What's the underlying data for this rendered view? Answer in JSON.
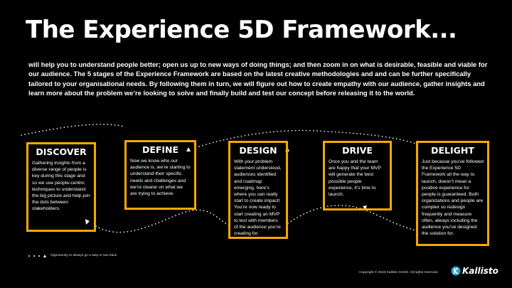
{
  "title": "The Experience 5D Framework...",
  "intro": "will help you to understand people better; open us up to new ways of doing things; and then zoom in on what is desirable, feasible and viable for our audience. The 5 stages of the Experience Framework are based on the latest creative methodologies and and can be further specifically tailored to your organisational needs. By following them in turn, we will figure out how to create empathy with our audience, gather insights and learn more about the problem we’re looking to solve and finally build and test our concept before releasing it to the world.",
  "stages": [
    {
      "label": "DISCOVER",
      "text": "Gathering insights from a diverse range of people is key during this stage and so we use people-centric techniques to understand the big picture and help join the dots between stakeholders."
    },
    {
      "label": "DEFINE",
      "text": "Now we know who our audience is, we’re starting to understand their specific needs and challenges and we’re clearer on what we are trying to achieve."
    },
    {
      "label": "DESIGN",
      "text": "With your problem statement understood, audiences identified and roadmap emerging, here’s where you can really start to create impact! You’re now ready to start creating an MVP to test with members of the audience you’re creating for."
    },
    {
      "label": "DRIVE",
      "text": "Once you and the team are happy that your MVP will generate the best possible people experience, it’s time to launch."
    },
    {
      "label": "DELIGHT",
      "text": "Just because you’ve followed the Experience 5D Framework all the way to launch, doesn’t mean a positive experience for people is guaranteed. Both organizations and people are complex so redesign frequently and measure often, always including the audience you’ve designed the solution for."
    }
  ],
  "legend": "Opportunity to always go a step or two back",
  "copyright": "Copyright © 2023 Kallisto GmbH. All rights reserved.",
  "logo": {
    "word": "Kallisto",
    "icon": "kallisto-logo-icon"
  },
  "colors": {
    "accent": "#f7a800",
    "background": "#000000",
    "text": "#ffffff",
    "logo": "#2aa4d5"
  }
}
